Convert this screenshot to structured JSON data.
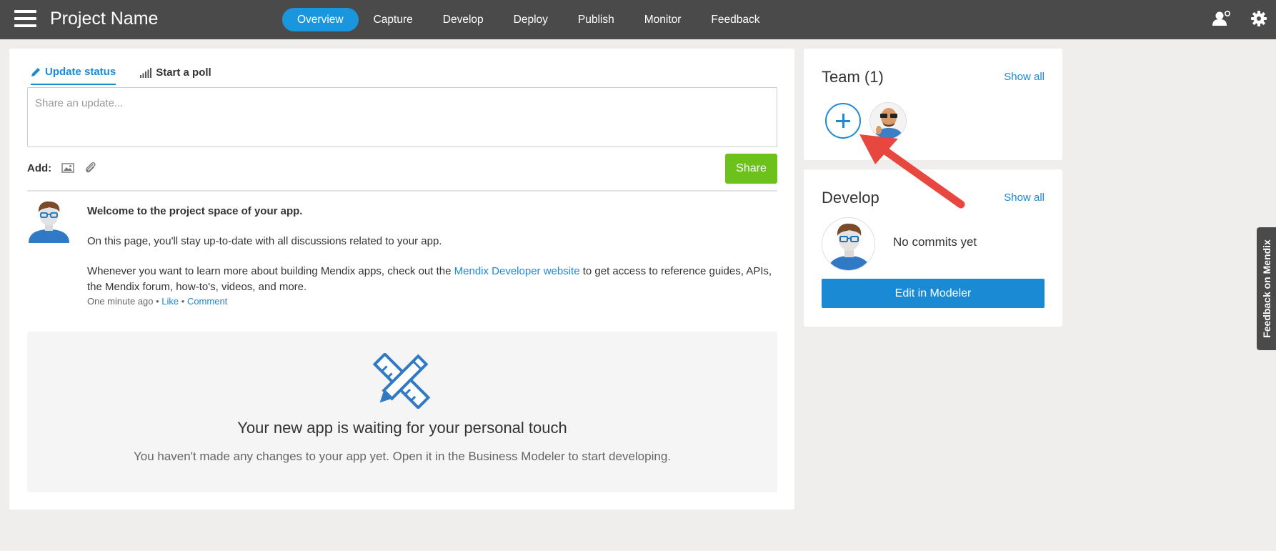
{
  "topbar": {
    "title": "Project Name",
    "nav": [
      {
        "label": "Overview",
        "active": true
      },
      {
        "label": "Capture"
      },
      {
        "label": "Develop"
      },
      {
        "label": "Deploy"
      },
      {
        "label": "Publish"
      },
      {
        "label": "Monitor"
      },
      {
        "label": "Feedback"
      }
    ],
    "icons": [
      "menu-icon",
      "user-settings-icon",
      "gear-icon"
    ]
  },
  "composer": {
    "tabs": [
      "Update status",
      "Start a poll"
    ],
    "placeholder": "Share an update...",
    "add_label": "Add:",
    "share_label": "Share"
  },
  "post": {
    "lead": "Welcome to the project space of your app.",
    "line1": "On this page, you'll stay up-to-date with all discussions related to your app.",
    "line2_before": "Whenever you want to learn more about building Mendix apps, check out the ",
    "line2_link": "Mendix Developer website",
    "line2_after": " to get access to reference guides, APIs, the Mendix forum, how-to's, videos, and more.",
    "time": "One minute ago",
    "sep": " • ",
    "like": "Like",
    "comment": "Comment"
  },
  "empty_state": {
    "title": "Your new app is waiting for your personal touch",
    "subtitle": "You haven't made any changes to your app yet. Open it in the Business Modeler to start developing."
  },
  "team": {
    "title": "Team (1)",
    "show_all": "Show all"
  },
  "develop": {
    "title": "Develop",
    "show_all": "Show all",
    "no_commits": "No commits yet",
    "edit_label": "Edit in Modeler"
  },
  "feedback_tab": "Feedback on Mendix",
  "colors": {
    "topbar": "#4a4a4a",
    "accent": "#1a96df",
    "link": "#1a8ad4",
    "share": "#6cc21b",
    "arrow": "#e8473f"
  }
}
